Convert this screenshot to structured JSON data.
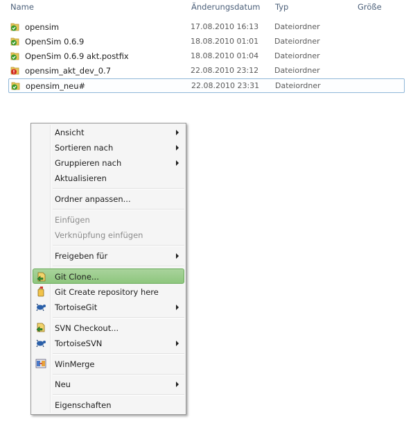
{
  "columns": {
    "name": "Name",
    "date": "Änderungsdatum",
    "type": "Typ",
    "size": "Größe"
  },
  "files": [
    {
      "name": "opensim",
      "date": "17.08.2010 16:13",
      "type": "Dateiordner",
      "status": "ok"
    },
    {
      "name": "OpenSim 0.6.9",
      "date": "18.08.2010 01:01",
      "type": "Dateiordner",
      "status": "ok"
    },
    {
      "name": "OpenSim 0.6.9 akt.postfix",
      "date": "18.08.2010 01:04",
      "type": "Dateiordner",
      "status": "ok"
    },
    {
      "name": "opensim_akt_dev_0.7",
      "date": "22.08.2010 23:12",
      "type": "Dateiordner",
      "status": "conflict"
    },
    {
      "name": "opensim_neu#",
      "date": "22.08.2010 23:31",
      "type": "Dateiordner",
      "status": "ok"
    }
  ],
  "context_menu": {
    "items": [
      {
        "label": "Ansicht",
        "submenu": true
      },
      {
        "label": "Sortieren nach",
        "submenu": true
      },
      {
        "label": "Gruppieren nach",
        "submenu": true
      },
      {
        "label": "Aktualisieren"
      },
      {
        "label": "Ordner anpassen..."
      },
      {
        "label": "Einfügen",
        "disabled": true
      },
      {
        "label": "Verknüpfung einfügen",
        "disabled": true
      },
      {
        "label": "Freigeben für",
        "submenu": true
      },
      {
        "label": "Git Clone...",
        "icon": "git-clone-icon",
        "highlighted": true
      },
      {
        "label": "Git Create repository here",
        "icon": "git-create-repo-icon"
      },
      {
        "label": "TortoiseGit",
        "icon": "tortoisegit-icon",
        "submenu": true
      },
      {
        "label": "SVN Checkout...",
        "icon": "svn-checkout-icon"
      },
      {
        "label": "TortoiseSVN",
        "icon": "tortoisesvn-icon",
        "submenu": true
      },
      {
        "label": "WinMerge",
        "icon": "winmerge-icon"
      },
      {
        "label": "Neu",
        "submenu": true
      },
      {
        "label": "Eigenschaften"
      }
    ]
  },
  "colors": {
    "highlight": "#8ec67e",
    "header_text": "#4c607a",
    "ok_badge": "#3a9a2a",
    "conflict_badge": "#d22a1e",
    "folder": "#e8c55a"
  }
}
